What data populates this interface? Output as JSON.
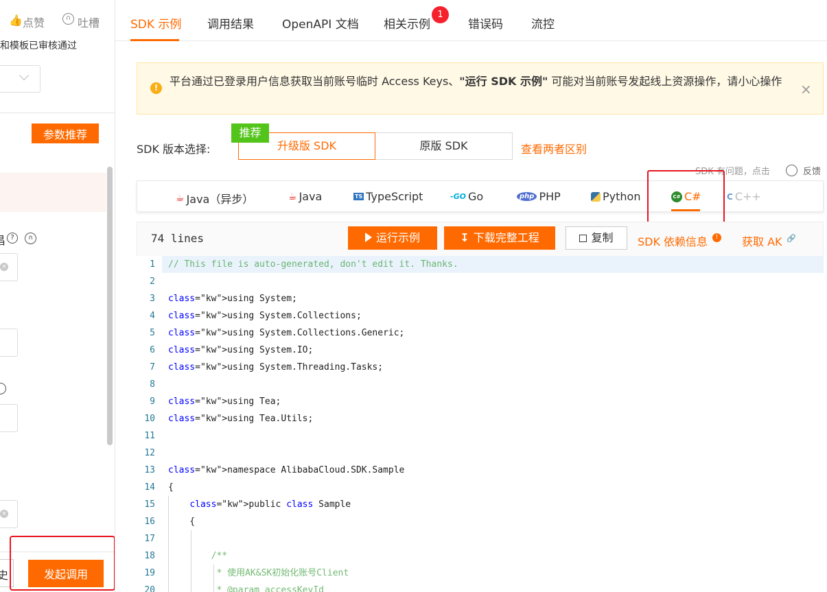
{
  "left_panel": {
    "like_label": "点赞",
    "complain_label": "吐槽",
    "status_text": "和模板已审核通过",
    "param_recommend_button": "参数推荐",
    "field_label_cut": "昌",
    "history_label_cut": "史",
    "invoke_button": "发起调用"
  },
  "tabs": [
    {
      "label": "SDK 示例",
      "active": true
    },
    {
      "label": "调用结果"
    },
    {
      "label": "OpenAPI 文档"
    },
    {
      "label": "相关示例",
      "badge": "1"
    },
    {
      "label": "错误码"
    },
    {
      "label": "流控"
    }
  ],
  "notice": {
    "text_before": "平台通过已登录用户信息获取当前账号临时 Access Keys、",
    "text_bold": "\"运行 SDK 示例\"",
    "text_after": " 可能对当前账号发起线上资源操作，请小心操作"
  },
  "sdk_version": {
    "label": "SDK 版本选择:",
    "recommend_tag": "推荐",
    "upgraded": "升级版 SDK",
    "original": "原版 SDK",
    "compare_link": "查看两者区别",
    "feedback_text": "SDK 有问题，点击",
    "feedback_label": "反馈"
  },
  "languages": [
    {
      "label": "Java（异步）",
      "icon": "java-icon"
    },
    {
      "label": "Java",
      "icon": "java-icon"
    },
    {
      "label": "TypeScript",
      "icon": "typescript-icon",
      "icon_text": "TS"
    },
    {
      "label": "Go",
      "icon": "go-icon",
      "icon_text": "-GO"
    },
    {
      "label": "PHP",
      "icon": "php-icon",
      "icon_text": "php"
    },
    {
      "label": "Python",
      "icon": "python-icon"
    },
    {
      "label": "C#",
      "icon": "csharp-icon",
      "icon_text": "C#",
      "active": true
    },
    {
      "label": "C++",
      "icon": "cpp-icon",
      "icon_text": "C++"
    }
  ],
  "toolbar": {
    "lines_count": "74 lines",
    "run_button": "运行示例",
    "download_button": "下载完整工程",
    "copy_button": "复制",
    "dependency_link": "SDK 依赖信息",
    "get_ak_link": "获取 AK"
  },
  "code_lines": [
    {
      "n": "1",
      "t": "// This file is auto-generated, don't edit it. Thanks."
    },
    {
      "n": "2",
      "t": ""
    },
    {
      "n": "3",
      "t": "using System;"
    },
    {
      "n": "4",
      "t": "using System.Collections;"
    },
    {
      "n": "5",
      "t": "using System.Collections.Generic;"
    },
    {
      "n": "6",
      "t": "using System.IO;"
    },
    {
      "n": "7",
      "t": "using System.Threading.Tasks;"
    },
    {
      "n": "8",
      "t": ""
    },
    {
      "n": "9",
      "t": "using Tea;"
    },
    {
      "n": "10",
      "t": "using Tea.Utils;"
    },
    {
      "n": "11",
      "t": ""
    },
    {
      "n": "12",
      "t": ""
    },
    {
      "n": "13",
      "t": "namespace AlibabaCloud.SDK.Sample"
    },
    {
      "n": "14",
      "t": "{"
    },
    {
      "n": "15",
      "t": "    public class Sample"
    },
    {
      "n": "16",
      "t": "    {"
    },
    {
      "n": "17",
      "t": ""
    },
    {
      "n": "18",
      "t": "        /**"
    },
    {
      "n": "19",
      "t": "         * 使用AK&SK初始化账号Client"
    },
    {
      "n": "20",
      "t": "         * @param accessKeyId"
    }
  ],
  "colors": {
    "accent": "#ff6a00",
    "highlight_box": "#e8131c",
    "recommend_tag": "#52c41a",
    "code_keyword": "#0000ff",
    "code_comment": "#008000",
    "line_number": "#237893"
  }
}
